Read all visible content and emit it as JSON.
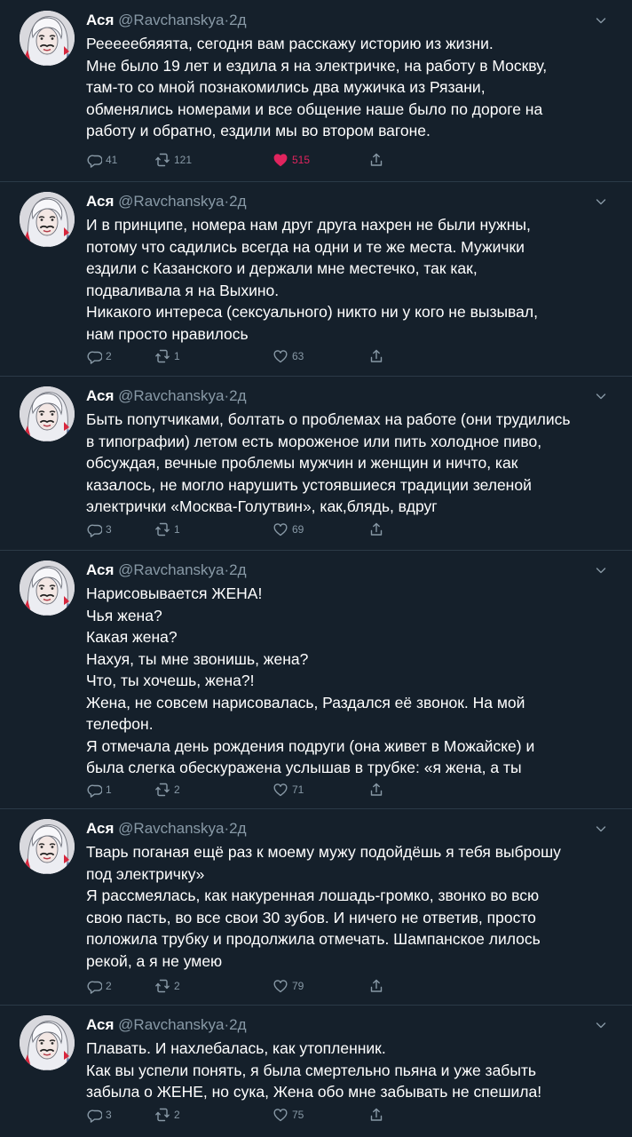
{
  "tweets": [
    {
      "name": "Ася",
      "handle": "@Ravchanskya",
      "dot": "·",
      "time": "2д",
      "lines": [
        "Рееееебяяята, сегодня вам расскажу историю из жизни.",
        "Мне было 19 лет и ездила я на электричке, на работу в Москву,",
        "там-то со мной познакомились два мужичка из Рязани,",
        "обменялись номерами и все общение наше было по дороге на",
        "работу и обратно, ездили мы во втором вагоне."
      ],
      "replies": "41",
      "retweets": "121",
      "likes": "515",
      "liked": true
    },
    {
      "name": "Ася",
      "handle": "@Ravchanskya",
      "dot": "·",
      "time": "2д",
      "lines": [
        "И в принципе, номера нам друг друга нахрен не были нужны,",
        "потому что садились всегда на одни и те же места. Мужички",
        "ездили с Казанского и держали мне местечко, так как,",
        "подваливала я на Выхино.",
        "Никакого интереса (сексуального) никто ни у кого не вызывал,",
        "нам просто нравилось"
      ],
      "replies": "2",
      "retweets": "1",
      "likes": "63",
      "liked": false
    },
    {
      "name": "Ася",
      "handle": "@Ravchanskya",
      "dot": "·",
      "time": "2д",
      "lines": [
        "Быть попутчиками, болтать о проблемах на работе (они трудились",
        "в типографии) летом есть мороженое или пить холодное пиво,",
        "обсуждая, вечные проблемы мужчин и женщин и ничто, как",
        "казалось, не могло нарушить устоявшиеся традиции зеленой",
        "электрички «Москва-Голутвин», как,блядь, вдруг"
      ],
      "replies": "3",
      "retweets": "1",
      "likes": "69",
      "liked": false
    },
    {
      "name": "Ася",
      "handle": "@Ravchanskya",
      "dot": "·",
      "time": "2д",
      "lines": [
        "Нарисовывается ЖЕНА!",
        "Чья жена?",
        "Какая жена?",
        "Нахуя, ты мне звонишь, жена?",
        "Что, ты хочешь, жена?!",
        "Жена, не совсем нарисовалась, Раздался её звонок. На мой",
        "телефон.",
        "Я отмечала день рождения подруги (она живет в Можайске) и",
        "была слегка обескуражена услышав в трубке: «я жена, а ты"
      ],
      "replies": "1",
      "retweets": "2",
      "likes": "71",
      "liked": false
    },
    {
      "name": "Ася",
      "handle": "@Ravchanskya",
      "dot": "·",
      "time": "2д",
      "lines": [
        "Тварь поганая ещё раз к моему мужу подойдёшь я тебя выброшу",
        "под электричку»",
        "Я рассмеялась, как накуренная лошадь-громко, звонко во всю",
        "свою пасть, во все свои 30 зубов. И ничего не ответив, просто",
        "положила трубку и продолжила отмечать. Шампанское лилось",
        "рекой, а я не умею"
      ],
      "replies": "2",
      "retweets": "2",
      "likes": "79",
      "liked": false
    },
    {
      "name": "Ася",
      "handle": "@Ravchanskya",
      "dot": "·",
      "time": "2д",
      "lines": [
        "Плавать. И нахлебалась, как утопленник.",
        "Как вы успели понять, я была смертельно пьяна и уже забыть",
        "забыла о ЖЕНЕ, но сука, Жена обо мне забывать не спешила!"
      ],
      "replies": "3",
      "retweets": "2",
      "likes": "75",
      "liked": false
    }
  ],
  "colors": {
    "background": "#15202b",
    "text": "#ffffff",
    "secondary": "#8899a6",
    "like": "#e0245e",
    "divider": "#2b3a47"
  },
  "icons": [
    "reply-icon",
    "retweet-icon",
    "like-icon",
    "share-icon",
    "chevron-down-icon",
    "avatar"
  ]
}
